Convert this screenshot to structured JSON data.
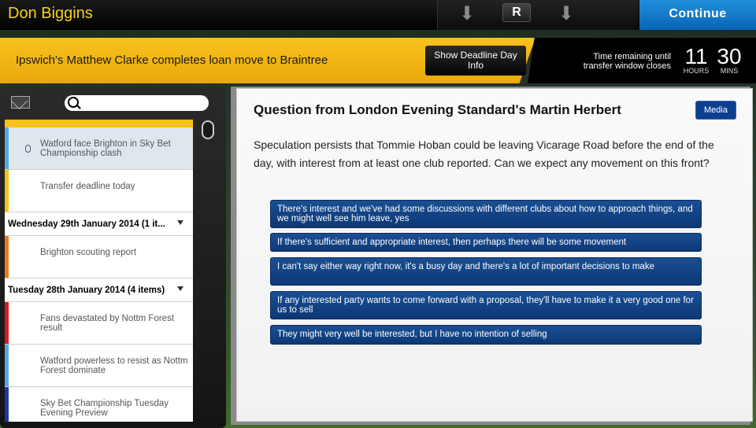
{
  "header": {
    "manager_name": "Don Biggins",
    "nav_down_left": "⬇",
    "nav_r_label": "R",
    "nav_down_right": "⬇",
    "continue_label": "Continue"
  },
  "news_band": {
    "headline": "Ipswich's Matthew Clarke completes loan move to Braintree",
    "deadline_button": "Show Deadline Day Info",
    "timer_caption": "Time remaining until transfer window closes",
    "hours": "11",
    "hours_unit": "HOURS",
    "mins": "30",
    "mins_unit": "MINS"
  },
  "inbox": {
    "items": [
      {
        "type": "message",
        "text": "Watford face Brighton in Sky Bet Championship clash",
        "accent": "#5aa7e0",
        "selected": true,
        "attachment": true
      },
      {
        "type": "message",
        "text": "Transfer deadline today",
        "accent": "#f7c21b"
      },
      {
        "type": "date",
        "text": "Wednesday 29th January 2014 (1 it..."
      },
      {
        "type": "message",
        "text": "Brighton scouting report",
        "accent": "#ef7a1a"
      },
      {
        "type": "date",
        "text": "Tuesday 28th January 2014 (4 items)"
      },
      {
        "type": "message",
        "text": "Fans devastated by Nottm Forest result",
        "accent": "#d81d1d"
      },
      {
        "type": "message",
        "text": "Watford powerless to resist as Nottm Forest dominate",
        "accent": "#5aa7e0"
      },
      {
        "type": "message",
        "text": "Sky Bet Championship Tuesday Evening Preview",
        "accent": "#1d3a9c"
      }
    ]
  },
  "question": {
    "title": "Question from London Evening Standard's Martin Herbert",
    "badge": "Media",
    "body": "Speculation persists that Tommie Hoban could be leaving Vicarage Road before the end of the day, with interest from at least one club reported. Can we expect any movement on this front?",
    "responses": [
      "There's interest and we've had some discussions with different clubs about how to approach things, and we might well see him leave, yes",
      "If there's sufficient and appropriate interest, then perhaps there will be some movement",
      "I can't say either way right now, it's a busy day and there's a lot of important decisions to make",
      "If any interested party wants to come forward with a proposal, they'll have to make it a very good one for us to sell",
      "They might very well be interested, but I have no intention of selling"
    ]
  }
}
